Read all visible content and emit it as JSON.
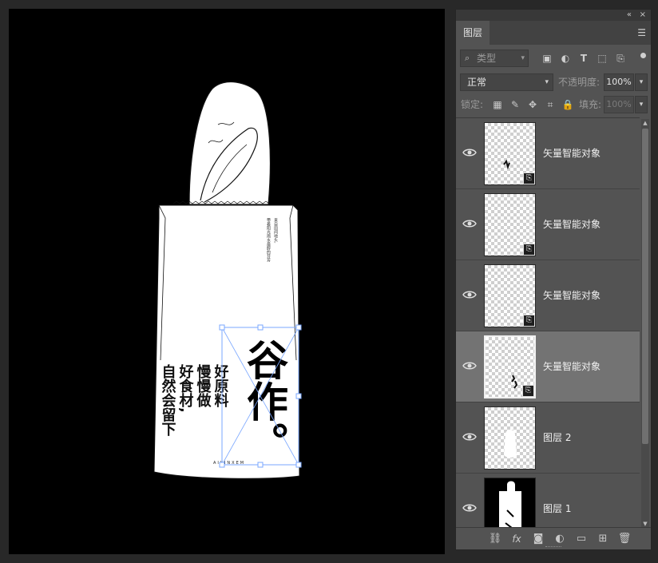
{
  "layers_panel": {
    "collapse_glyph": "«",
    "close_glyph": "×",
    "tab_label": "图层",
    "menu_icon": "menu-icon",
    "filter": {
      "icon": "search-icon",
      "placeholder": "类型"
    },
    "filter_icons": [
      "pixel-layer-filter-icon",
      "adjustment-filter-icon",
      "type-filter-icon",
      "shape-filter-icon",
      "smart-object-filter-icon"
    ],
    "blend_mode": "正常",
    "opacity_label": "不透明度:",
    "opacity_value": "100%",
    "lock_label": "锁定:",
    "lock_icons": [
      "lock-transparent-icon",
      "lock-image-icon",
      "lock-position-icon",
      "lock-artboard-icon",
      "lock-all-icon"
    ],
    "fill_label": "填充:",
    "fill_value": "100%",
    "layers": [
      {
        "name": "矢量智能对象",
        "visible": true,
        "selected": false,
        "type": "smart-object"
      },
      {
        "name": "矢量智能对象",
        "visible": true,
        "selected": false,
        "type": "smart-object"
      },
      {
        "name": "矢量智能对象",
        "visible": true,
        "selected": false,
        "type": "smart-object"
      },
      {
        "name": "矢量智能对象",
        "visible": true,
        "selected": true,
        "type": "smart-object"
      },
      {
        "name": "图层 2",
        "visible": true,
        "selected": false,
        "type": "pixel"
      },
      {
        "name": "图层 1",
        "visible": true,
        "selected": false,
        "type": "pixel"
      }
    ],
    "bottom_icons": [
      "link-layers-icon",
      "fx-icon",
      "add-mask-icon",
      "new-adjustment-icon",
      "new-group-icon",
      "new-layer-icon",
      "delete-icon"
    ]
  },
  "canvas": {
    "calligraphy": "谷作。",
    "slogan_lines": [
      "好原料",
      "慢慢做",
      "好食材,",
      "自然会留下"
    ],
    "brand_mark": "AIYINXEM",
    "small_text": [
      "来自田间地头,",
      "带着阳光雨水最醇的芬芳"
    ]
  },
  "colors": {
    "panel_bg": "#535353",
    "selected_row": "#737373",
    "canvas_bg": "#000000",
    "transform_handle": "#7aa7ff"
  }
}
